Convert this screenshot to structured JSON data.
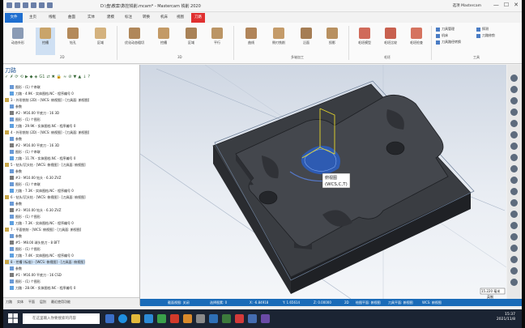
{
  "titlebar": {
    "title": "D:\\盘\\教案\\数控铣削.mcam* - Mastercam 铣削 2020",
    "contextual_tab": "刀路",
    "brand": "选项 Mastercam",
    "minimize": "—",
    "restore": "☐",
    "close": "✕"
  },
  "tabs": [
    "文件",
    "主页",
    "线框",
    "曲面",
    "实体",
    "建模",
    "标注",
    "转换",
    "机床",
    "视图",
    "刀路"
  ],
  "ribbon": {
    "buttons_2d": [
      "动态外形",
      "挖槽",
      "钻孔",
      "区域"
    ],
    "group_2d": "2D",
    "buttons_3d": [
      "优化动态粗切",
      "挖槽",
      "区域",
      "平行"
    ],
    "group_3d": "3D",
    "buttons_multi": [
      "曲线",
      "侧刃铣削",
      "沿面",
      "投影"
    ],
    "group_multi": "多轴加工",
    "buttons_tools": [
      "毛坯模型",
      "毛坯比较",
      "毛坯检查"
    ],
    "group_tools": "毛坯",
    "small_buttons": [
      "刀具管理",
      "机床",
      "刀具路径转换",
      "探测",
      "刀路修剪"
    ],
    "group_utility": "工具"
  },
  "panel": {
    "title": "刀路",
    "tabs": [
      "刀路",
      "实体",
      "平面",
      "层别",
      "最近使用功能"
    ],
    "rows": [
      {
        "text": "图形 - (1) 个串联",
        "level": 3,
        "type": "plain"
      },
      {
        "text": "刀路 - 4.9K - 实体图档.NC - 程序编号 0",
        "level": 3,
        "type": "path"
      },
      {
        "text": "3 - 外形铣削 (2D) - [WCS: 俯视图] - [刀具面: 俯视图]",
        "level": 2,
        "type": "op"
      },
      {
        "text": "参数",
        "level": 3,
        "type": "plain"
      },
      {
        "text": "#2 - M16.00 平底刀 - 16 3D",
        "level": 3,
        "type": "tool"
      },
      {
        "text": "图形 - (1) 个图形",
        "level": 3,
        "type": "plain"
      },
      {
        "text": "刀路 - 29.9K - 实体图档.NC - 程序编号 0",
        "level": 3,
        "type": "path"
      },
      {
        "text": "4 - 外形铣削 (2D) - [WCS: 俯视图] - [刀具面: 俯视图]",
        "level": 2,
        "type": "op"
      },
      {
        "text": "参数",
        "level": 3,
        "type": "plain"
      },
      {
        "text": "#2 - M16.00 平底刀 - 16 3D",
        "level": 3,
        "type": "tool"
      },
      {
        "text": "图形 - (1) 个串联",
        "level": 3,
        "type": "plain"
      },
      {
        "text": "刀路 - 11.7K - 实体图档.NC - 程序编号 0",
        "level": 3,
        "type": "path"
      },
      {
        "text": "5 - 钻头/沉头钻 - [WCS: 俯视图] - [刀具面: 俯视图]",
        "level": 2,
        "type": "op"
      },
      {
        "text": "参数",
        "level": 3,
        "type": "plain"
      },
      {
        "text": "#3 - M10.00 钻头 - 6.30 ZVZ",
        "level": 3,
        "type": "tool"
      },
      {
        "text": "图形 - (1) 个串联",
        "level": 3,
        "type": "plain"
      },
      {
        "text": "刀路 - 7.3K - 实体图档.NC - 程序编号 0",
        "level": 3,
        "type": "path"
      },
      {
        "text": "6 - 钻头/沉头钻 - [WCS: 俯视图] - [刀具面: 俯视图]",
        "level": 2,
        "type": "op"
      },
      {
        "text": "参数",
        "level": 3,
        "type": "plain"
      },
      {
        "text": "#3 - M10.00 钻头 - 6.30 ZVZ",
        "level": 3,
        "type": "tool"
      },
      {
        "text": "图形 - (1) 个图形",
        "level": 3,
        "type": "plain"
      },
      {
        "text": "刀路 - 7.3K - 实体图档.NC - 程序编号 0",
        "level": 3,
        "type": "path"
      },
      {
        "text": "7 - 平面铣削 - [WCS: 俯视图] - [刀具面: 俯视图]",
        "level": 2,
        "type": "op"
      },
      {
        "text": "参数",
        "level": 3,
        "type": "plain"
      },
      {
        "text": "#5 - M8.00 球头铣刀 - 8 BFT",
        "level": 3,
        "type": "tool"
      },
      {
        "text": "图形 - (1) 个图形",
        "level": 3,
        "type": "plain"
      },
      {
        "text": "刀路 - 7.4K - 实体图档.NC - 程序编号 0",
        "level": 3,
        "type": "path"
      },
      {
        "text": "8 - 挖槽 (标准) - [WCS: 俯视图] - [刀具面: 俯视图]",
        "level": 2,
        "type": "op-hl"
      },
      {
        "text": "参数",
        "level": 3,
        "type": "plain"
      },
      {
        "text": "#1 - M16.00 平底刀 - 16 CSD",
        "level": 3,
        "type": "tool"
      },
      {
        "text": "图形 - (1) 个图形",
        "level": 3,
        "type": "plain"
      },
      {
        "text": "刀路 - 28.0K - 实体图档.NC - 程序编号 0",
        "level": 3,
        "type": "path"
      }
    ]
  },
  "viewport": {
    "tooltip_line1": "俯视图",
    "tooltip_line2": "(WCS,C,T)",
    "scale_value": "15.220 毫米",
    "scale_unit": "英制"
  },
  "statusbar": {
    "section": "截面视图: 关闭",
    "selected": "选择图素: 0",
    "x": "X:  -6.84918",
    "y": "Y:  1.65614",
    "z": "Z:  0.00000",
    "mode": "2D",
    "cplane": "绘图平面: 俯视图",
    "tplane": "刀具平面: 俯视图",
    "wcs": "WCS: 俯视图"
  },
  "taskbar": {
    "search_placeholder": "在这里输入你要搜索的内容",
    "time": "15:37",
    "date": "2021/11/8"
  },
  "colors": {
    "file_tab": "#1f6fd0",
    "active_tab": "#e03030",
    "status_bar": "#1a6bb8",
    "part": "#3a3d42",
    "toolpath": "#2f6fd8"
  }
}
